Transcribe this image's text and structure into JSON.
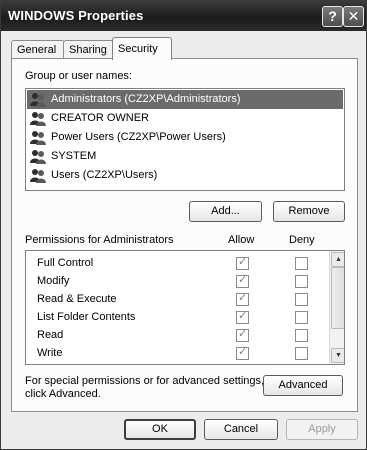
{
  "window": {
    "title": "WINDOWS Properties",
    "help_glyph": "?",
    "close_glyph": "✕"
  },
  "tabs": [
    {
      "label": "General",
      "active": false
    },
    {
      "label": "Sharing",
      "active": false
    },
    {
      "label": "Security",
      "active": true
    }
  ],
  "security": {
    "group_label": "Group or user names:",
    "users": [
      {
        "label": "Administrators (CZ2XP\\Administrators)",
        "selected": true
      },
      {
        "label": "CREATOR OWNER",
        "selected": false
      },
      {
        "label": "Power Users (CZ2XP\\Power Users)",
        "selected": false
      },
      {
        "label": "SYSTEM",
        "selected": false
      },
      {
        "label": "Users (CZ2XP\\Users)",
        "selected": false
      }
    ],
    "add_button": "Add...",
    "remove_button": "Remove",
    "permissions_label": "Permissions for Administrators",
    "allow_header": "Allow",
    "deny_header": "Deny",
    "permissions": [
      {
        "name": "Full Control",
        "allow": true,
        "deny": false
      },
      {
        "name": "Modify",
        "allow": true,
        "deny": false
      },
      {
        "name": "Read & Execute",
        "allow": true,
        "deny": false
      },
      {
        "name": "List Folder Contents",
        "allow": true,
        "deny": false
      },
      {
        "name": "Read",
        "allow": true,
        "deny": false
      },
      {
        "name": "Write",
        "allow": true,
        "deny": false
      }
    ],
    "advanced_text_line1": "For special permissions or for advanced settings,",
    "advanced_text_line2": "click Advanced.",
    "advanced_button": "Advanced"
  },
  "footer": {
    "ok": "OK",
    "cancel": "Cancel",
    "apply": "Apply",
    "apply_enabled": false
  },
  "colors": {
    "selection": "#6b6b6b",
    "titlebar": "#2a2a2a"
  },
  "icons": {
    "user": "user-group-icon",
    "check": "✓"
  }
}
